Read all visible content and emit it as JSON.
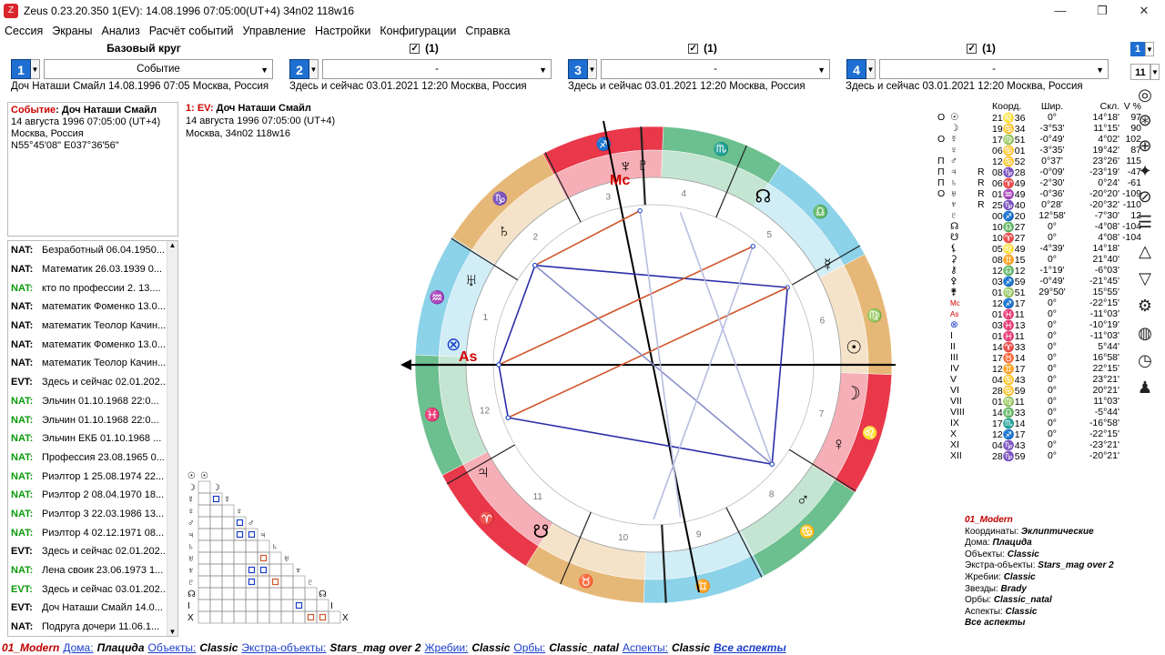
{
  "window": {
    "icon": "Z",
    "title": "Zeus   0.23.20.350    1(EV): 14.08.1996 07:05:00(UT+4)  34n02 118w16",
    "minimize": "—",
    "maximize": "❐",
    "close": "✕"
  },
  "menu": [
    "Сессия",
    "Экраны",
    "Анализ",
    "Расчёт событий",
    "Управление",
    "Настройки",
    "Конфигурации",
    "Справка"
  ],
  "panels": [
    {
      "header": "Базовый круг",
      "checked": false,
      "num": "1",
      "combo": "Событие",
      "subline": "Доч Наташи Смайл 14.08.1996 07:05 Москва, Россия"
    },
    {
      "header": "(1)",
      "checked": true,
      "num": "2",
      "combo": "-",
      "subline": "Здесь и сейчас 03.01.2021 12:20 Москва, Россия"
    },
    {
      "header": "(1)",
      "checked": true,
      "num": "3",
      "combo": "-",
      "subline": "Здесь и сейчас 03.01.2021 12:20 Москва, Россия"
    },
    {
      "header": "(1)",
      "checked": true,
      "num": "4",
      "combo": "-",
      "subline": "Здесь и сейчас 03.01.2021 12:20 Москва, Россия"
    }
  ],
  "event": {
    "label": "Событие",
    "name": ": Доч Наташи Смайл",
    "date": "14 августа 1996 07:05:00 (UT+4)",
    "place": "Москва, Россия",
    "coords": "N55°45'08\" E037°36'56\""
  },
  "list": [
    {
      "tag": "NAT:",
      "green": false,
      "text": "Безработный 06.04.1950..."
    },
    {
      "tag": "NAT:",
      "green": false,
      "text": "Математик 26.03.1939 0..."
    },
    {
      "tag": "NAT:",
      "green": true,
      "text": "кто по профессии 2. 13...."
    },
    {
      "tag": "NAT:",
      "green": false,
      "text": "математик Фоменко 13.0..."
    },
    {
      "tag": "NAT:",
      "green": false,
      "text": "математик Теолор Качин..."
    },
    {
      "tag": "NAT:",
      "green": false,
      "text": "математик Фоменко 13.0..."
    },
    {
      "tag": "NAT:",
      "green": false,
      "text": "математик Теолор Качин..."
    },
    {
      "tag": "EVT:",
      "green": false,
      "text": "Здесь и сейчас 02.01.202..."
    },
    {
      "tag": "NAT:",
      "green": true,
      "text": "Эльчин 01.10.1968 22:0..."
    },
    {
      "tag": "NAT:",
      "green": true,
      "text": "Эльчин 01.10.1968 22:0..."
    },
    {
      "tag": "NAT:",
      "green": true,
      "text": "Эльчин ЕКБ 01.10.1968 ..."
    },
    {
      "tag": "NAT:",
      "green": true,
      "text": "Профессия 23.08.1965 0..."
    },
    {
      "tag": "NAT:",
      "green": true,
      "text": "Риэлтор 1 25.08.1974 22..."
    },
    {
      "tag": "NAT:",
      "green": true,
      "text": "Риэлтор 2 08.04.1970 18..."
    },
    {
      "tag": "NAT:",
      "green": true,
      "text": "Риэлтор 3 22.03.1986 13..."
    },
    {
      "tag": "NAT:",
      "green": true,
      "text": "Риэлтор 4 02.12.1971 08..."
    },
    {
      "tag": "EVT:",
      "green": false,
      "text": "Здесь и сейчас 02.01.202..."
    },
    {
      "tag": "NAT:",
      "green": true,
      "text": "Лена своик 23.06.1973 1..."
    },
    {
      "tag": "EVT:",
      "green": true,
      "text": "Здесь и сейчас 03.01.202..."
    },
    {
      "tag": "EVT:",
      "green": false,
      "text": "Доч Наташи Смайл 14.0..."
    },
    {
      "tag": "NAT:",
      "green": false,
      "text": "Подруга дочери 11.06.1..."
    }
  ],
  "chart_info": {
    "prefix": "1: EV:",
    "name": " Доч Наташи Смайл",
    "date": "14 августа 1996 07:05:00 (UT+4)",
    "place": "Москва, 34n02 118w16"
  },
  "table": {
    "headers": [
      "Коорд.",
      "Шир.",
      "Скл.",
      "V %"
    ],
    "rows": [
      {
        "flag": "О",
        "sym": "☉",
        "r": "",
        "coord": "21♌36",
        "lat": "0°",
        "decl": "14°18'",
        "v": "97"
      },
      {
        "flag": "",
        "sym": "☽",
        "r": "",
        "coord": "19♋34",
        "lat": "-3°53'",
        "decl": "11°15'",
        "v": "90"
      },
      {
        "flag": "О",
        "sym": "☿",
        "r": "",
        "coord": "17♍51",
        "lat": "-0°49'",
        "decl": "4°02'",
        "v": "102"
      },
      {
        "flag": "",
        "sym": "♀",
        "r": "",
        "coord": "06♋01",
        "lat": "-3°35'",
        "decl": "19°42'",
        "v": "87"
      },
      {
        "flag": "П",
        "sym": "♂",
        "r": "",
        "coord": "12♋52",
        "lat": "0°37'",
        "decl": "23°26'",
        "v": "115"
      },
      {
        "flag": "П",
        "sym": "♃",
        "r": "R",
        "coord": "08♑28",
        "lat": "-0°09'",
        "decl": "-23°19'",
        "v": "-47"
      },
      {
        "flag": "П",
        "sym": "♄",
        "r": "R",
        "coord": "06♈49",
        "lat": "-2°30'",
        "decl": "0°24'",
        "v": "-61"
      },
      {
        "flag": "О",
        "sym": "♅",
        "r": "R",
        "coord": "01♒49",
        "lat": "-0°36'",
        "decl": "-20°20'",
        "v": "-109"
      },
      {
        "flag": "",
        "sym": "♆",
        "r": "R",
        "coord": "25♑40",
        "lat": "0°28'",
        "decl": "-20°32'",
        "v": "-110"
      },
      {
        "flag": "",
        "sym": "♇",
        "r": "",
        "coord": "00♐20",
        "lat": "12°58'",
        "decl": "-7°30'",
        "v": "12"
      },
      {
        "flag": "",
        "sym": "☊",
        "r": "",
        "coord": "10♎27",
        "lat": "0°",
        "decl": "-4°08'",
        "v": "-104"
      },
      {
        "flag": "",
        "sym": "☋",
        "r": "",
        "coord": "10♈27",
        "lat": "0°",
        "decl": "4°08'",
        "v": "-104"
      },
      {
        "flag": "",
        "sym": "⚸",
        "r": "",
        "coord": "05♌49",
        "lat": "-4°39'",
        "decl": "14°18'",
        "v": ""
      },
      {
        "flag": "",
        "sym": "⚳",
        "r": "",
        "coord": "08♊15",
        "lat": "0°",
        "decl": "21°40'",
        "v": ""
      },
      {
        "flag": "",
        "sym": "⚷",
        "r": "",
        "coord": "12♎12",
        "lat": "-1°19'",
        "decl": "-6°03'",
        "v": ""
      },
      {
        "flag": "",
        "sym": "⚴",
        "r": "",
        "coord": "03♐59",
        "lat": "-0°49'",
        "decl": "-21°45'",
        "v": ""
      },
      {
        "flag": "",
        "sym": "⚵",
        "r": "",
        "coord": "01♍51",
        "lat": "29°50'",
        "decl": "15°55'",
        "v": ""
      },
      {
        "flag": "",
        "sym": "Mc",
        "r": "",
        "coord": "12♐17",
        "lat": "0°",
        "decl": "-22°15'",
        "v": ""
      },
      {
        "flag": "",
        "sym": "As",
        "r": "",
        "coord": "01♓11",
        "lat": "0°",
        "decl": "-11°03'",
        "v": ""
      },
      {
        "flag": "",
        "sym": "⊗",
        "r": "",
        "coord": "03♓13",
        "lat": "0°",
        "decl": "-10°19'",
        "v": ""
      },
      {
        "flag": "",
        "sym": "I",
        "r": "",
        "coord": "01♓11",
        "lat": "0°",
        "decl": "-11°03'",
        "v": ""
      },
      {
        "flag": "",
        "sym": "II",
        "r": "",
        "coord": "14♈33",
        "lat": "0°",
        "decl": "5°44'",
        "v": ""
      },
      {
        "flag": "",
        "sym": "III",
        "r": "",
        "coord": "17♉14",
        "lat": "0°",
        "decl": "16°58'",
        "v": ""
      },
      {
        "flag": "",
        "sym": "IV",
        "r": "",
        "coord": "12♊17",
        "lat": "0°",
        "decl": "22°15'",
        "v": ""
      },
      {
        "flag": "",
        "sym": "V",
        "r": "",
        "coord": "04♋43",
        "lat": "0°",
        "decl": "23°21'",
        "v": ""
      },
      {
        "flag": "",
        "sym": "VI",
        "r": "",
        "coord": "28♋59",
        "lat": "0°",
        "decl": "20°21'",
        "v": ""
      },
      {
        "flag": "",
        "sym": "VII",
        "r": "",
        "coord": "01♍11",
        "lat": "0°",
        "decl": "11°03'",
        "v": ""
      },
      {
        "flag": "",
        "sym": "VIII",
        "r": "",
        "coord": "14♎33",
        "lat": "0°",
        "decl": "-5°44'",
        "v": ""
      },
      {
        "flag": "",
        "sym": "IX",
        "r": "",
        "coord": "17♏14",
        "lat": "0°",
        "decl": "-16°58'",
        "v": ""
      },
      {
        "flag": "",
        "sym": "X",
        "r": "",
        "coord": "12♐17",
        "lat": "0°",
        "decl": "-22°15'",
        "v": ""
      },
      {
        "flag": "",
        "sym": "XI",
        "r": "",
        "coord": "04♑43",
        "lat": "0°",
        "decl": "-23°21'",
        "v": ""
      },
      {
        "flag": "",
        "sym": "XII",
        "r": "",
        "coord": "28♑59",
        "lat": "0°",
        "decl": "-20°21'",
        "v": ""
      }
    ]
  },
  "settings": [
    {
      "k": "",
      "v": "01_Modern"
    },
    {
      "k": "Координаты: ",
      "v": "Эклиптические"
    },
    {
      "k": "Дома: ",
      "v": "Плацида"
    },
    {
      "k": "Объекты: ",
      "v": "Classic"
    },
    {
      "k": "Экстра-объекты: ",
      "v": "Stars_mag over 2"
    },
    {
      "k": "Жребии: ",
      "v": "Classic"
    },
    {
      "k": "Звезды: ",
      "v": "Brady"
    },
    {
      "k": "Орбы: ",
      "v": "Classic_natal"
    },
    {
      "k": "Аспекты: ",
      "v": "Classic"
    },
    {
      "k": "",
      "v": "Все аспекты"
    }
  ],
  "status": {
    "config": "01_Modern",
    "houses_label": "Дома:",
    "houses": "Плацида",
    "objects_label": "Объекты:",
    "objects": "Classic",
    "extra_label": "Экстра-объекты:",
    "extra": "Stars_mag over 2",
    "lots_label": "Жребии:",
    "lots": "Classic",
    "orbs_label": "Орбы:",
    "orbs": "Classic_natal",
    "aspects_label": "Аспекты:",
    "aspects": "Classic",
    "all_aspects": "Все аспекты"
  },
  "toolbar": {
    "num": "1",
    "count": "11"
  },
  "wheel": {
    "mc_label": "Mc",
    "as_label": "As",
    "signs": [
      "♈",
      "♉",
      "♊",
      "♋",
      "♌",
      "♍",
      "♎",
      "♏",
      "♐",
      "♑",
      "♒",
      "♓"
    ],
    "house_numbers": [
      "1",
      "2",
      "3",
      "4",
      "5",
      "6",
      "7",
      "8",
      "9",
      "10",
      "11",
      "12"
    ],
    "grid_planets": [
      "☉",
      "☽",
      "☿",
      "♀",
      "♂",
      "♃",
      "♄",
      "♅",
      "♆",
      "♇",
      "☊",
      "I",
      "X"
    ]
  },
  "colors": {
    "accent": "#1e6fd1",
    "fire": "#e8384a",
    "earth": "#e6b878",
    "air": "#8cd2e8",
    "water": "#6cbf8e",
    "aspect_blue": "#2a2fa8",
    "aspect_red": "#d0562a"
  }
}
